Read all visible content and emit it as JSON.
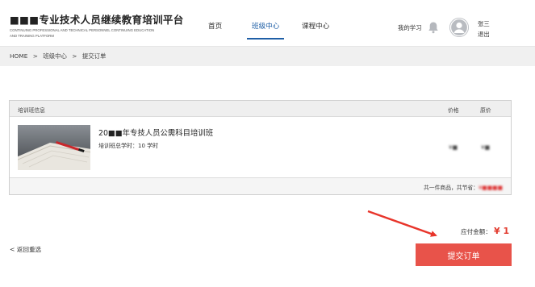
{
  "header": {
    "logo_title": "■■■专业技术人员继续教育培训平台",
    "logo_sub_1": "CONTINUING PROFESSIONAL AND TECHNICAL PERSONNEL CONTINUING EDUCATION",
    "logo_sub_2": "AND TRAINING PLATFORM",
    "nav": [
      {
        "label": "首页"
      },
      {
        "label": "班级中心"
      },
      {
        "label": "课程中心"
      }
    ],
    "my_study": "我的学习",
    "user_name": "张三",
    "logout": "退出",
    "accent_color": "#1f5fa6"
  },
  "breadcrumb": {
    "home": "HOME",
    "sep": ">",
    "level1": "班级中心",
    "level2": "提交订单"
  },
  "order": {
    "col_info": "培训班信息",
    "col_price": "价格",
    "col_orig": "原价",
    "course_title": "20■■年专技人员公需科目培训班",
    "course_hours": "培训班总学时：10 学时",
    "price": "¥■",
    "orig_price": "¥■",
    "footer_prefix": "共一件商品，共节省：",
    "footer_saving": "¥■■■■"
  },
  "payment": {
    "label": "应付金额：",
    "amount": "¥ 1",
    "amount_color": "#e23b2e"
  },
  "actions": {
    "back": "< 返回重选",
    "submit": "提交订单",
    "submit_color": "#e8534a"
  }
}
